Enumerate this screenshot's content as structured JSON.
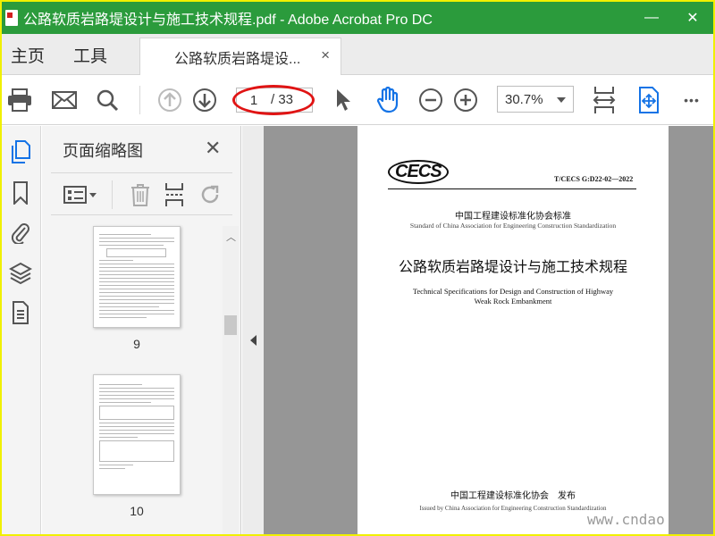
{
  "window": {
    "title": "公路软质岩路堤设计与施工技术规程.pdf - Adobe Acrobat Pro DC",
    "minimize": "—",
    "close": "✕",
    "title_bar_color": "#2b9b3c"
  },
  "menubar": {
    "home": "主页",
    "tools": "工具",
    "tab_label": "公路软质岩路堤设...",
    "tab_close": "×"
  },
  "toolbar": {
    "page_current": "1",
    "page_total": "/ 33",
    "zoom": "30.7%",
    "more": "•••",
    "highlight_color": "#e01414"
  },
  "thumbnails": {
    "title": "页面缩略图",
    "close": "✕",
    "pages": [
      {
        "label": "9"
      },
      {
        "label": "10"
      }
    ]
  },
  "document": {
    "logo": "CECS",
    "standard_number": "T/CECS G:D22-02—2022",
    "assoc_cn": "中国工程建设标准化协会标准",
    "assoc_en": "Standard of China Association for Engineering Construction Standardization",
    "title_cn": "公路软质岩路堤设计与施工技术规程",
    "title_en_1": "Technical Specifications for Design and Construction of Highway",
    "title_en_2": "Weak Rock Embankment",
    "issuer_cn": "中国工程建设标准化协会　发布",
    "issuer_en": "Issued by China Association for Engineering Construction Standardization"
  },
  "watermark": "www.cndao"
}
